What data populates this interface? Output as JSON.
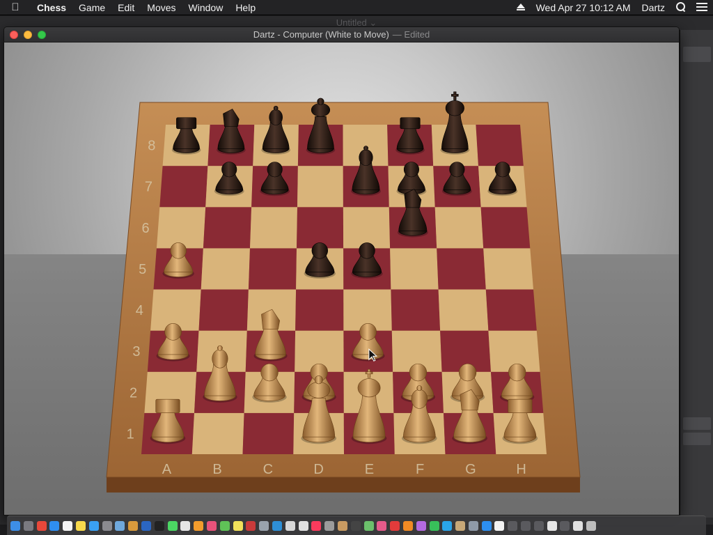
{
  "menubar": {
    "apple_icon": "apple-logo",
    "items": [
      {
        "label": "Chess",
        "bold": true
      },
      {
        "label": "Game",
        "bold": false
      },
      {
        "label": "Edit",
        "bold": false
      },
      {
        "label": "Moves",
        "bold": false
      },
      {
        "label": "Window",
        "bold": false
      },
      {
        "label": "Help",
        "bold": false
      }
    ],
    "clock": "Wed Apr 27  10:12 AM",
    "user": "Dartz"
  },
  "background_window": {
    "title": "Untitled ⌄"
  },
  "window": {
    "title": "Dartz - Computer   (White to Move)",
    "edited": "— Edited"
  },
  "board": {
    "files": [
      "A",
      "B",
      "C",
      "D",
      "E",
      "F",
      "G",
      "H"
    ],
    "ranks": [
      "1",
      "2",
      "3",
      "4",
      "5",
      "6",
      "7",
      "8"
    ],
    "light_color": "#d9b47a",
    "dark_color": "#8a2a34",
    "frame_color": "#b27a44",
    "pieces": [
      {
        "file": "a",
        "rank": 8,
        "color": "black",
        "type": "rook"
      },
      {
        "file": "b",
        "rank": 8,
        "color": "black",
        "type": "knight"
      },
      {
        "file": "c",
        "rank": 8,
        "color": "black",
        "type": "bishop"
      },
      {
        "file": "d",
        "rank": 8,
        "color": "black",
        "type": "queen"
      },
      {
        "file": "f",
        "rank": 8,
        "color": "black",
        "type": "rook"
      },
      {
        "file": "g",
        "rank": 8,
        "color": "black",
        "type": "king"
      },
      {
        "file": "b",
        "rank": 7,
        "color": "black",
        "type": "pawn"
      },
      {
        "file": "c",
        "rank": 7,
        "color": "black",
        "type": "pawn"
      },
      {
        "file": "e",
        "rank": 7,
        "color": "black",
        "type": "bishop"
      },
      {
        "file": "f",
        "rank": 7,
        "color": "black",
        "type": "pawn"
      },
      {
        "file": "g",
        "rank": 7,
        "color": "black",
        "type": "pawn"
      },
      {
        "file": "h",
        "rank": 7,
        "color": "black",
        "type": "pawn"
      },
      {
        "file": "f",
        "rank": 6,
        "color": "black",
        "type": "knight"
      },
      {
        "file": "d",
        "rank": 5,
        "color": "black",
        "type": "pawn"
      },
      {
        "file": "e",
        "rank": 5,
        "color": "black",
        "type": "pawn"
      },
      {
        "file": "a",
        "rank": 5,
        "color": "white",
        "type": "pawn"
      },
      {
        "file": "a",
        "rank": 3,
        "color": "white",
        "type": "pawn"
      },
      {
        "file": "c",
        "rank": 3,
        "color": "white",
        "type": "knight"
      },
      {
        "file": "e",
        "rank": 3,
        "color": "white",
        "type": "pawn"
      },
      {
        "file": "b",
        "rank": 2,
        "color": "white",
        "type": "bishop"
      },
      {
        "file": "c",
        "rank": 2,
        "color": "white",
        "type": "pawn"
      },
      {
        "file": "d",
        "rank": 2,
        "color": "white",
        "type": "pawn"
      },
      {
        "file": "f",
        "rank": 2,
        "color": "white",
        "type": "pawn"
      },
      {
        "file": "g",
        "rank": 2,
        "color": "white",
        "type": "pawn"
      },
      {
        "file": "h",
        "rank": 2,
        "color": "white",
        "type": "pawn"
      },
      {
        "file": "a",
        "rank": 1,
        "color": "white",
        "type": "rook"
      },
      {
        "file": "d",
        "rank": 1,
        "color": "white",
        "type": "queen"
      },
      {
        "file": "e",
        "rank": 1,
        "color": "white",
        "type": "king"
      },
      {
        "file": "f",
        "rank": 1,
        "color": "white",
        "type": "bishop"
      },
      {
        "file": "g",
        "rank": 1,
        "color": "white",
        "type": "knight"
      },
      {
        "file": "h",
        "rank": 1,
        "color": "white",
        "type": "rook"
      }
    ]
  },
  "dock": {
    "icons": [
      {
        "name": "finder-icon",
        "color": "#3d8ee6"
      },
      {
        "name": "launchpad-icon",
        "color": "#7a7a80"
      },
      {
        "name": "chrome-icon",
        "color": "#e8483a"
      },
      {
        "name": "safari-icon",
        "color": "#2f8ef0"
      },
      {
        "name": "calendar-icon",
        "color": "#f4f4f4"
      },
      {
        "name": "notes-icon",
        "color": "#f7d94c"
      },
      {
        "name": "app-store-icon",
        "color": "#3aa0f2"
      },
      {
        "name": "system-preferences-icon",
        "color": "#8b8b90"
      },
      {
        "name": "preview-icon",
        "color": "#6fa8dc"
      },
      {
        "name": "books-icon",
        "color": "#d99a3c"
      },
      {
        "name": "word-icon",
        "color": "#2b66c2"
      },
      {
        "name": "terminal-icon",
        "color": "#222222"
      },
      {
        "name": "messages-app-icon",
        "color": "#4bd663"
      },
      {
        "name": "document-icon",
        "color": "#e6e6e6"
      },
      {
        "name": "pages-icon",
        "color": "#f39c2c"
      },
      {
        "name": "keynote-icon",
        "color": "#e8527a"
      },
      {
        "name": "numbers-icon",
        "color": "#5fc257"
      },
      {
        "name": "stickies-icon",
        "color": "#f1e05a"
      },
      {
        "name": "photo-booth-icon",
        "color": "#c93a3a"
      },
      {
        "name": "image-capture-icon",
        "color": "#9aa3ad"
      },
      {
        "name": "edge-icon",
        "color": "#2e8fd6"
      },
      {
        "name": "calculator-icon",
        "color": "#d8d8d8"
      },
      {
        "name": "files-icon",
        "color": "#e0e0e0"
      },
      {
        "name": "music-icon",
        "color": "#fa3b5d"
      },
      {
        "name": "automator-icon",
        "color": "#9b9b9b"
      },
      {
        "name": "chess-icon",
        "color": "#c99b62"
      },
      {
        "name": "activity-icon",
        "color": "#444444"
      },
      {
        "name": "maps-icon",
        "color": "#6bbf6b"
      },
      {
        "name": "photos-icon",
        "color": "#e55b8b"
      },
      {
        "name": "news-icon",
        "color": "#e23b3b"
      },
      {
        "name": "home-icon",
        "color": "#f08a24"
      },
      {
        "name": "game-center-icon",
        "color": "#b46ae0"
      },
      {
        "name": "facetime-icon",
        "color": "#38c05a"
      },
      {
        "name": "xcode-icon",
        "color": "#2aa4e8"
      },
      {
        "name": "contacts-icon",
        "color": "#c7a878"
      },
      {
        "name": "script-icon",
        "color": "#8f9aa8"
      },
      {
        "name": "appstore-alt-icon",
        "color": "#2d8ff0"
      },
      {
        "name": "textedit-icon",
        "color": "#f3f3f3"
      },
      {
        "name": "folder-icon-1",
        "color": "#5a5a5e"
      },
      {
        "name": "folder-icon-2",
        "color": "#5a5a5e"
      },
      {
        "name": "folder-icon-3",
        "color": "#5a5a5e"
      },
      {
        "name": "window-icon",
        "color": "#e6e6e6"
      },
      {
        "name": "window-icon-2",
        "color": "#5a5a5e"
      },
      {
        "name": "window-icon-3",
        "color": "#e0e0e0"
      },
      {
        "name": "trash-icon",
        "color": "#bdbdbd"
      }
    ]
  }
}
